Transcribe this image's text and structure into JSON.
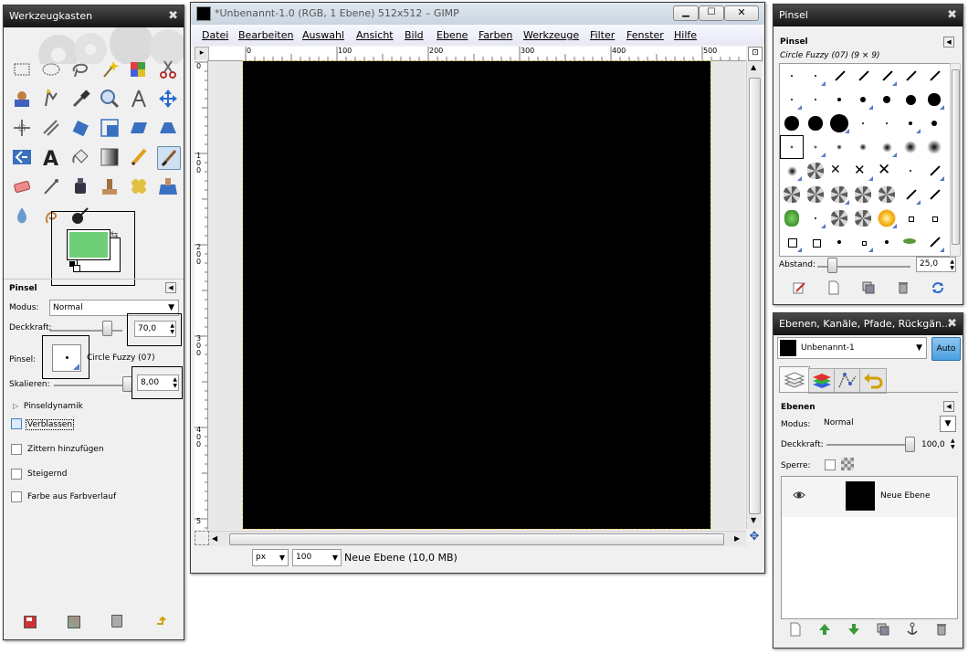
{
  "toolbox": {
    "title": "Werkzeugkasten",
    "options_title": "Pinsel",
    "mode_label": "Modus:",
    "mode_value": "Normal",
    "opacity_label": "Deckkraft:",
    "opacity_value": "70,0",
    "brush_label": "Pinsel:",
    "brush_value": "Circle Fuzzy (07)",
    "scale_label": "Skalieren:",
    "scale_value": "8,00",
    "dynamics_label": "Pinseldynamik",
    "fade_label": "Verblassen",
    "jitter_label": "Zittern hinzufügen",
    "incremental_label": "Steigernd",
    "gradient_label": "Farbe aus Farbverlauf",
    "fg_color": "#6fcf77",
    "bg_color": "#ffffff"
  },
  "image_window": {
    "title": "*Unbenannt-1.0 (RGB, 1 Ebene) 512x512 – GIMP",
    "menu": [
      "Datei",
      "Bearbeiten",
      "Auswahl",
      "Ansicht",
      "Bild",
      "Ebene",
      "Farben",
      "Werkzeuge",
      "Filter",
      "Fenster",
      "Hilfe"
    ],
    "hruler": [
      "0",
      "100",
      "200",
      "300",
      "400",
      "500"
    ],
    "vruler": [
      "0",
      "1\n0\n0",
      "2\n0\n0",
      "3\n0\n0",
      "4\n0\n0",
      "5"
    ],
    "unit": "px",
    "zoom": "100",
    "status": "Neue Ebene (10,0 MB)",
    "canvas_color": "#000000"
  },
  "brushes": {
    "title": "Pinsel",
    "header": "Pinsel",
    "current": "Circle Fuzzy (07) (9 × 9)",
    "spacing_label": "Abstand:",
    "spacing_value": "25,0"
  },
  "layers": {
    "title": "Ebenen, Kanäle, Pfade, Rückgän...",
    "image_name": "Unbenannt-1",
    "auto_label": "Auto",
    "header": "Ebenen",
    "mode_label": "Modus:",
    "mode_value": "Normal",
    "opacity_label": "Deckkraft:",
    "opacity_value": "100,0",
    "lock_label": "Sperre:",
    "layer_name": "Neue Ebene"
  }
}
